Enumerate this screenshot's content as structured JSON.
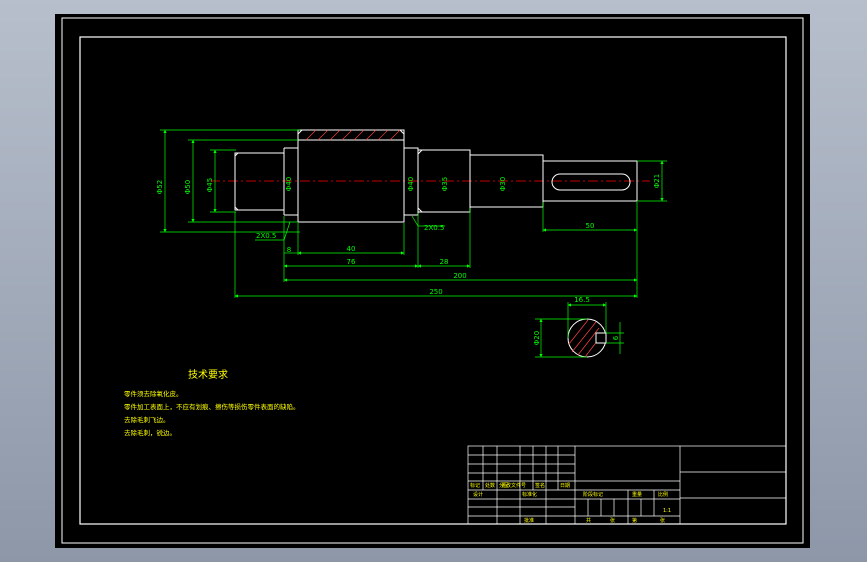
{
  "drawing": {
    "tech_title": "技术要求",
    "tech_notes": [
      "零件须去除氧化皮。",
      "零件加工表面上，不应有划痕、擦伤等损伤零件表面的缺陷。",
      "去除毛刺飞边。",
      "去除毛刺，锐边。"
    ],
    "diameters": {
      "d1": "Φ52",
      "d2": "Φ50",
      "d3": "Φ45",
      "d4": "Φ40",
      "d5": "Φ40",
      "d6": "Φ35",
      "d7": "Φ30",
      "d8": "Φ21"
    },
    "chamfers": {
      "left": "2X0.5",
      "right": "2X0.5"
    },
    "lengths": {
      "l_8": "8",
      "l_40": "40",
      "l_76": "76",
      "l_28": "28",
      "l_50": "50",
      "l_200": "200",
      "l_250": "250"
    },
    "section": {
      "width": "16.5",
      "dia": "Φ20",
      "key": "6"
    },
    "title_block": {
      "h_mark": "标记",
      "h_count": "处数",
      "h_zone": "分区",
      "h_docno": "更改文件号",
      "h_sign": "签名",
      "h_date": "日期",
      "designer": "设计",
      "std": "标准化",
      "h_stage": "阶段标记",
      "h_weight": "重量",
      "h_ratio": "比例",
      "scale": "1:1",
      "approve": "批准",
      "sheets_total": "共",
      "sheet": "张",
      "sheet_no": "第"
    }
  },
  "colors": {
    "background": "#000000",
    "frame": "#ffffff",
    "part": "#ffffff",
    "dimension": "#00ff00",
    "centerline": "#ff0000",
    "text": "#ffff00",
    "hatch": "#ff4444",
    "viewport": "#8d97a8"
  }
}
